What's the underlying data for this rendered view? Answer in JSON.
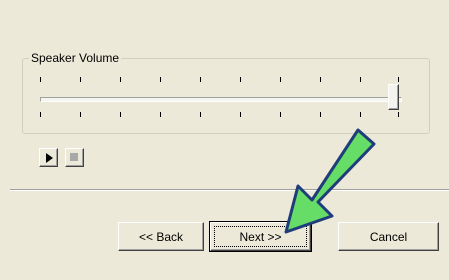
{
  "volume_group": {
    "label": "Speaker Volume",
    "slider_level_percent": 100
  },
  "media_controls": {
    "play_icon": "play-icon",
    "stop_icon": "stop-icon"
  },
  "buttons": {
    "back_label": "<< Back",
    "next_label": "Next >>",
    "cancel_label": "Cancel"
  },
  "annotation": {
    "arrow_color": "#66dd66",
    "arrow_outline": "#1f3d7a"
  }
}
